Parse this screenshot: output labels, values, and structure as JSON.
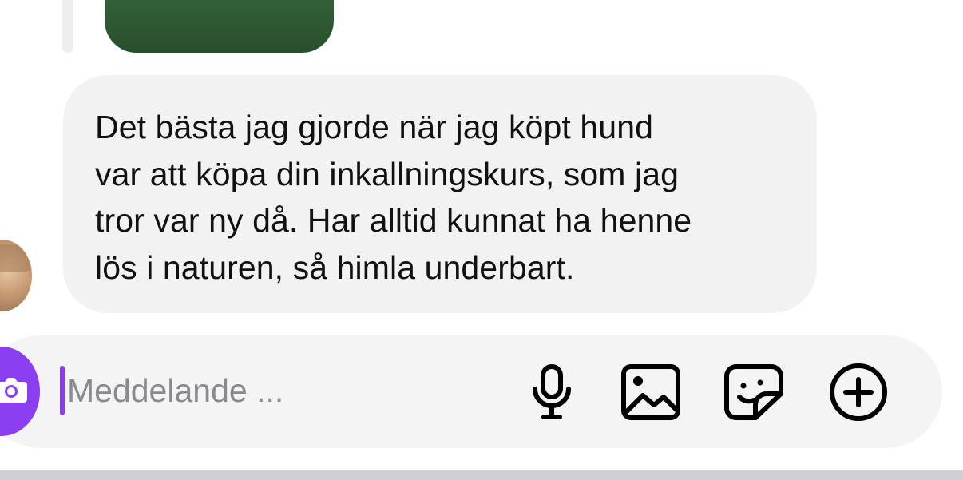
{
  "message": {
    "text": "Det bästa jag gjorde när jag köpt hund\nvar att köpa din inkallningskurs, som jag\ntror var ny då. Har alltid kunnat ha henne\nlös i naturen, så himla underbart."
  },
  "composer": {
    "placeholder": "Meddelande ...",
    "icons": [
      "camera-icon",
      "microphone-icon",
      "image-icon",
      "sticker-icon",
      "plus-circle-icon"
    ]
  },
  "colors": {
    "accent": "#8b3df0",
    "bubble": "#f2f2f3",
    "composer": "#f4f4f5",
    "text": "#111111",
    "placeholder": "#8a8a8e"
  }
}
